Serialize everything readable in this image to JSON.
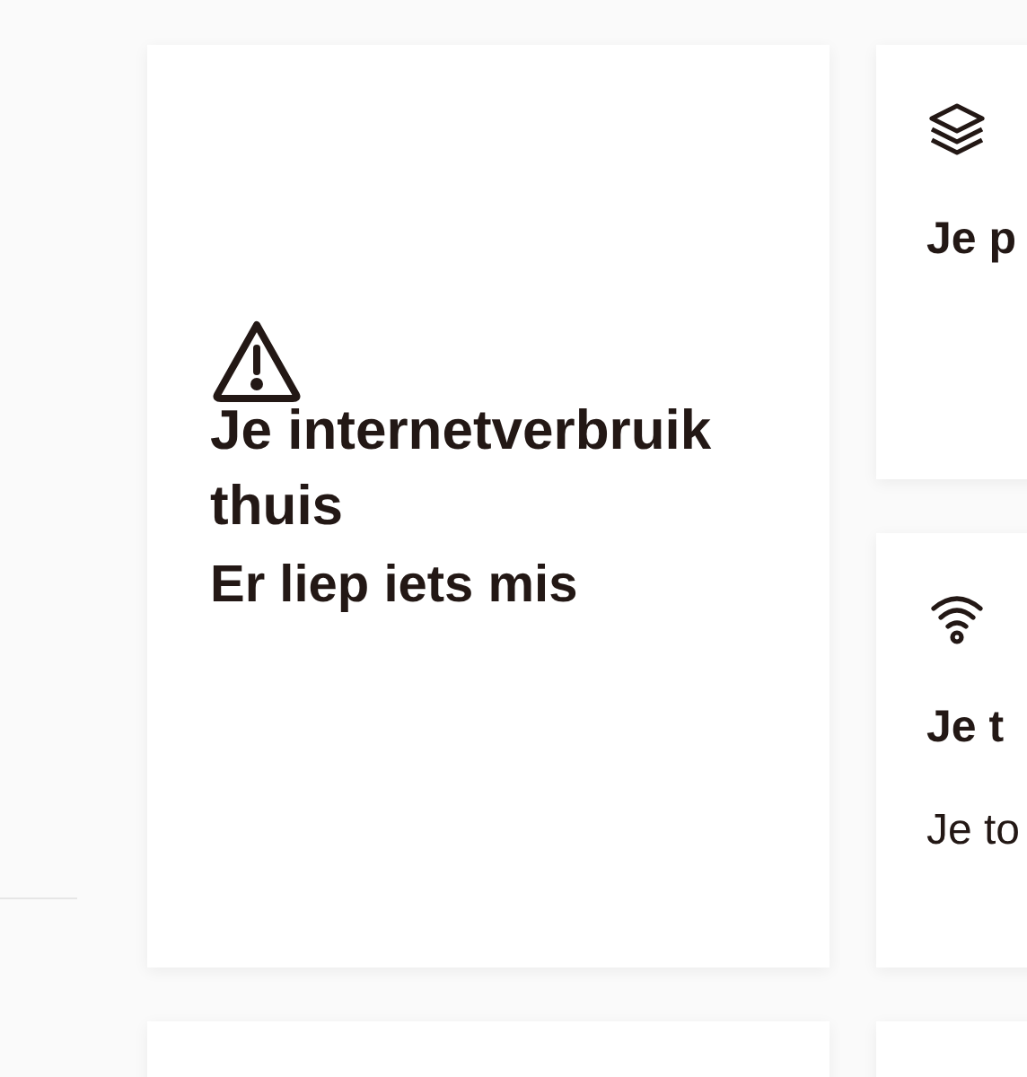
{
  "cards": [
    {
      "kind": "error",
      "title": "Je internetverbruik thuis",
      "message": "Er liep iets mis"
    },
    {
      "kind": "tile",
      "title": "Je p"
    },
    {
      "kind": "tile",
      "title": "Je t",
      "message": "Je to"
    }
  ]
}
